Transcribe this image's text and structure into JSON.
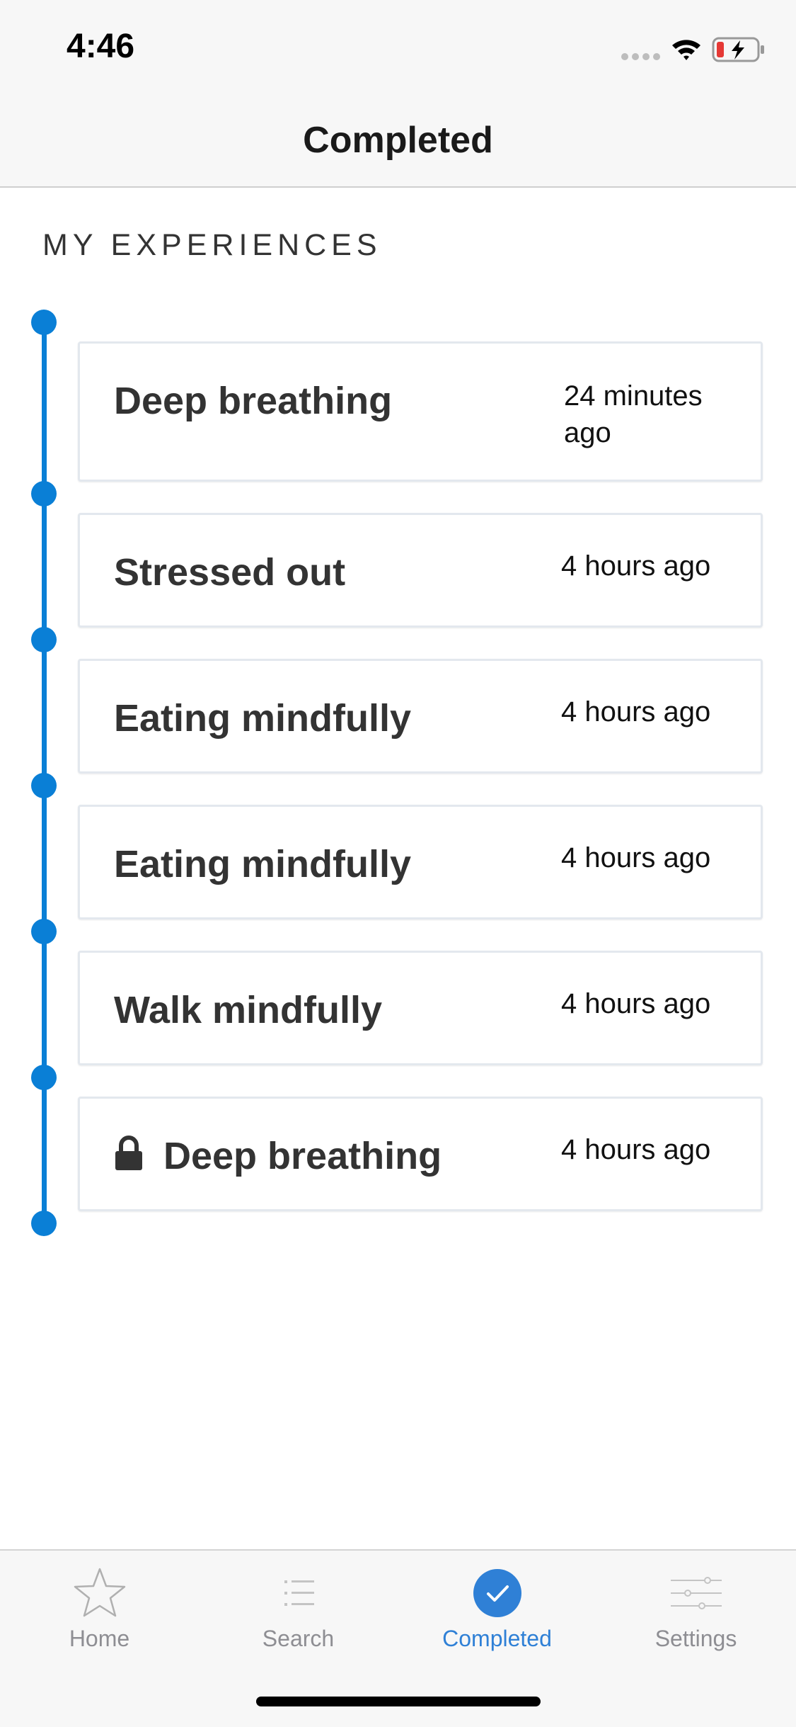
{
  "status_bar": {
    "time": "4:46"
  },
  "nav": {
    "title": "Completed"
  },
  "section": {
    "header": "MY EXPERIENCES"
  },
  "colors": {
    "accent": "#0a7fd6",
    "tab_active": "#2f80d6",
    "tab_inactive": "#8e8e93",
    "battery_low": "#e53935"
  },
  "experiences": [
    {
      "title": "Deep breathing",
      "time": "24 minutes ago",
      "locked": false
    },
    {
      "title": "Stressed out",
      "time": "4 hours ago",
      "locked": false
    },
    {
      "title": "Eating mindfully",
      "time": "4 hours ago",
      "locked": false
    },
    {
      "title": "Eating mindfully",
      "time": "4 hours ago",
      "locked": false
    },
    {
      "title": "Walk mindfully",
      "time": "4 hours ago",
      "locked": false
    },
    {
      "title": "Deep breathing",
      "time": "4 hours ago",
      "locked": true,
      "icon": "lock-icon"
    }
  ],
  "tabs": [
    {
      "label": "Home",
      "icon": "star-icon",
      "active": false
    },
    {
      "label": "Search",
      "icon": "list-icon",
      "active": false
    },
    {
      "label": "Completed",
      "icon": "checkmark-circle-icon",
      "active": true
    },
    {
      "label": "Settings",
      "icon": "sliders-icon",
      "active": false
    }
  ]
}
